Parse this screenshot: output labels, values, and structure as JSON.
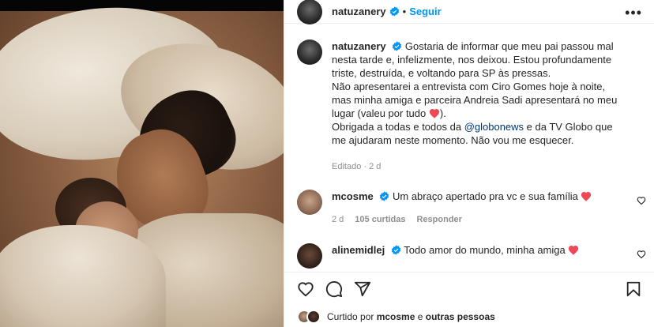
{
  "post": {
    "username": "natuzanery",
    "follow_label": "Seguir",
    "more_label": "•••"
  },
  "caption": {
    "username": "natuzanery",
    "text_1": "Gostaria de informar que meu pai passou mal nesta tarde e, infelizmente, nos deixou. Estou profundamente triste, destruída, e voltando para SP às pressas.",
    "text_2": "Não apresentarei a entrevista com Ciro Gomes hoje à noite, mas minha amiga e parceira Andreia Sadi apresentará no meu lugar (valeu por tudo",
    "text_2_end": ").",
    "text_3_a": "Obrigada a todas e todos da ",
    "mention_1": "@globonews",
    "text_3_b": " e da TV Globo que me ajudaram neste momento. Não vou me esquecer.",
    "meta": "Editado · 2 d"
  },
  "comments": [
    {
      "username": "mcosme",
      "text": "Um abraço apertado pra vc e sua família",
      "age": "2 d",
      "likes": "105 curtidas",
      "reply": "Responder"
    },
    {
      "username": "alinemidlej",
      "text": "Todo amor do mundo, minha amiga"
    }
  ],
  "liked_by": {
    "prefix": "Curtido por ",
    "user": "mcosme",
    "middle": " e ",
    "others": "outras pessoas"
  },
  "colors": {
    "accent": "#0095f6",
    "heart": "#ed4956",
    "verified": "#0095f6",
    "mention": "#00376b"
  },
  "icons": [
    "verified-badge-icon",
    "more-options-icon",
    "heart-icon",
    "comment-icon",
    "share-icon",
    "bookmark-icon"
  ]
}
